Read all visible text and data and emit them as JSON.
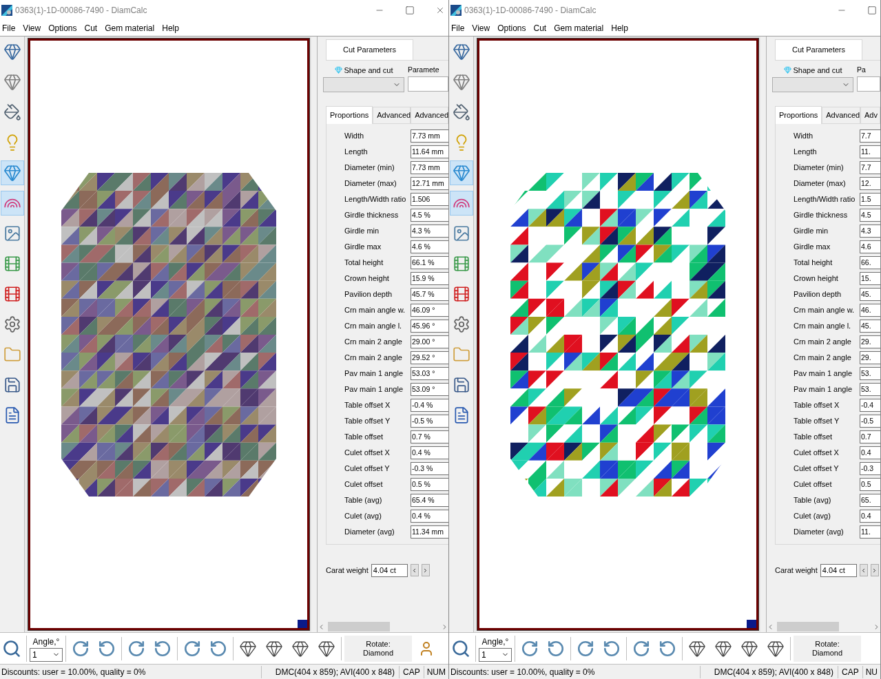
{
  "windows": [
    {
      "title": "0363(1)-1D-00086-7490 - DiamCalc",
      "close_button": true,
      "vivid": false,
      "menu": [
        "File",
        "View",
        "Options",
        "Cut",
        "Gem material",
        "Help"
      ],
      "side_tools": [
        {
          "kind": "gem",
          "pressed": false
        },
        {
          "kind": "gem-light",
          "pressed": false
        },
        {
          "kind": "bucket",
          "pressed": false
        },
        {
          "kind": "bulb",
          "pressed": false
        },
        {
          "kind": "gem-sparkle",
          "pressed": true
        },
        {
          "kind": "rainbow",
          "pressed": true
        },
        {
          "kind": "picture",
          "pressed": false
        },
        {
          "kind": "film-play",
          "pressed": false
        },
        {
          "kind": "film-record",
          "pressed": false
        },
        {
          "kind": "gem-gear",
          "pressed": false
        },
        {
          "kind": "folder",
          "pressed": false
        },
        {
          "kind": "save",
          "pressed": false
        },
        {
          "kind": "document",
          "pressed": false
        }
      ],
      "panel": {
        "top_tab": "Cut Parameters",
        "shape_label": "Shape and cut",
        "params_label": "Paramete",
        "tabs": [
          {
            "label": "Proportions",
            "selected": true
          },
          {
            "label": "Advanced",
            "selected": false
          },
          {
            "label": "Advanced",
            "selected": false
          }
        ],
        "rows": [
          {
            "label": "Width",
            "value": "7.73 mm"
          },
          {
            "label": "Length",
            "value": "11.64 mm"
          },
          {
            "label": "Diameter (min)",
            "value": "7.73 mm"
          },
          {
            "label": "Diameter (max)",
            "value": "12.71 mm"
          },
          {
            "label": "Length/Width ratio",
            "value": "1.506"
          },
          {
            "label": "Girdle thickness",
            "value": "4.5 %"
          },
          {
            "label": "Girdle min",
            "value": "4.3 %"
          },
          {
            "label": "Girdle max",
            "value": "4.6 %"
          },
          {
            "label": "Total height",
            "value": "66.1 %"
          },
          {
            "label": "Crown height",
            "value": "15.9 %"
          },
          {
            "label": "Pavilion depth",
            "value": "45.7 %"
          },
          {
            "label": "Crn main angle w.",
            "value": "46.09 °"
          },
          {
            "label": "Crn main angle l.",
            "value": "45.96 °"
          },
          {
            "label": "Crn main 2 angle",
            "value": "29.00 °"
          },
          {
            "label": "Crn main 2 angle",
            "value": "29.52 °"
          },
          {
            "label": "Pav main 1 angle",
            "value": "53.03 °"
          },
          {
            "label": "Pav main 1 angle",
            "value": "53.09 °"
          },
          {
            "label": "Table offset X",
            "value": "-0.4 %"
          },
          {
            "label": "Table offset Y",
            "value": "-0.5 %"
          },
          {
            "label": "Table offset",
            "value": "0.7 %"
          },
          {
            "label": "Culet offset X",
            "value": "0.4 %"
          },
          {
            "label": "Culet offset Y",
            "value": "-0.3 %"
          },
          {
            "label": "Culet offset",
            "value": "0.5 %"
          },
          {
            "label": "Table (avg)",
            "value": "65.4 %"
          },
          {
            "label": "Culet (avg)",
            "value": "0.4 %"
          },
          {
            "label": "Diameter (avg)",
            "value": "11.34 mm"
          }
        ],
        "carat_label": "Carat weight",
        "carat_value": "4.04 ct"
      },
      "toolbar": {
        "angle_label": "Angle,°",
        "angle_value": "1",
        "rotate_label": "Rotate:",
        "rotate_value": "Diamond",
        "user_icon": true
      },
      "status": {
        "discounts": "Discounts: user = 10.00%, quality = 0%",
        "sizes": "DMC(404 x 859); AVI(400 x 848)",
        "cap": "CAP",
        "num": "NUM"
      }
    },
    {
      "title": "0363(1)-1D-00086-7490 - DiamCalc",
      "close_button": false,
      "vivid": true,
      "menu": [
        "File",
        "View",
        "Options",
        "Cut",
        "Gem material",
        "Help"
      ],
      "side_tools": [
        {
          "kind": "gem",
          "pressed": false
        },
        {
          "kind": "gem-light",
          "pressed": false
        },
        {
          "kind": "bucket",
          "pressed": false
        },
        {
          "kind": "bulb",
          "pressed": false
        },
        {
          "kind": "gem-sparkle",
          "pressed": true
        },
        {
          "kind": "rainbow",
          "pressed": true
        },
        {
          "kind": "picture",
          "pressed": false
        },
        {
          "kind": "film-play",
          "pressed": false
        },
        {
          "kind": "film-record",
          "pressed": false
        },
        {
          "kind": "gem-gear",
          "pressed": false
        },
        {
          "kind": "folder",
          "pressed": false
        },
        {
          "kind": "save",
          "pressed": false
        },
        {
          "kind": "document",
          "pressed": false
        }
      ],
      "panel": {
        "top_tab": "Cut Parameters",
        "shape_label": "Shape and cut",
        "params_label": "Pa",
        "tabs": [
          {
            "label": "Proportions",
            "selected": true
          },
          {
            "label": "Advanced",
            "selected": false
          },
          {
            "label": "Adv",
            "selected": false
          }
        ],
        "rows": [
          {
            "label": "Width",
            "value": "7.7"
          },
          {
            "label": "Length",
            "value": "11."
          },
          {
            "label": "Diameter (min)",
            "value": "7.7"
          },
          {
            "label": "Diameter (max)",
            "value": "12."
          },
          {
            "label": "Length/Width ratio",
            "value": "1.5"
          },
          {
            "label": "Girdle thickness",
            "value": "4.5"
          },
          {
            "label": "Girdle min",
            "value": "4.3"
          },
          {
            "label": "Girdle max",
            "value": "4.6"
          },
          {
            "label": "Total height",
            "value": "66."
          },
          {
            "label": "Crown height",
            "value": "15."
          },
          {
            "label": "Pavilion depth",
            "value": "45."
          },
          {
            "label": "Crn main angle w.",
            "value": "46."
          },
          {
            "label": "Crn main angle l.",
            "value": "45."
          },
          {
            "label": "Crn main 2 angle",
            "value": "29."
          },
          {
            "label": "Crn main 2 angle",
            "value": "29."
          },
          {
            "label": "Pav main 1 angle",
            "value": "53."
          },
          {
            "label": "Pav main 1 angle",
            "value": "53."
          },
          {
            "label": "Table offset X",
            "value": "-0.4"
          },
          {
            "label": "Table offset Y",
            "value": "-0.5"
          },
          {
            "label": "Table offset",
            "value": "0.7"
          },
          {
            "label": "Culet offset X",
            "value": "0.4"
          },
          {
            "label": "Culet offset Y",
            "value": "-0.3"
          },
          {
            "label": "Culet offset",
            "value": "0.5"
          },
          {
            "label": "Table (avg)",
            "value": "65."
          },
          {
            "label": "Culet (avg)",
            "value": "0.4"
          },
          {
            "label": "Diameter (avg)",
            "value": "11."
          }
        ],
        "carat_label": "Carat weight",
        "carat_value": "4.04 ct"
      },
      "toolbar": {
        "angle_label": "Angle,°",
        "angle_value": "1",
        "rotate_label": "Rotate:",
        "rotate_value": "Diamond",
        "user_icon": false
      },
      "status": {
        "discounts": "Discounts: user = 10.00%, quality = 0%",
        "sizes": "DMC(404 x 859); AVI(400 x 848)",
        "cap": "CAP",
        "num": "NU"
      }
    }
  ]
}
